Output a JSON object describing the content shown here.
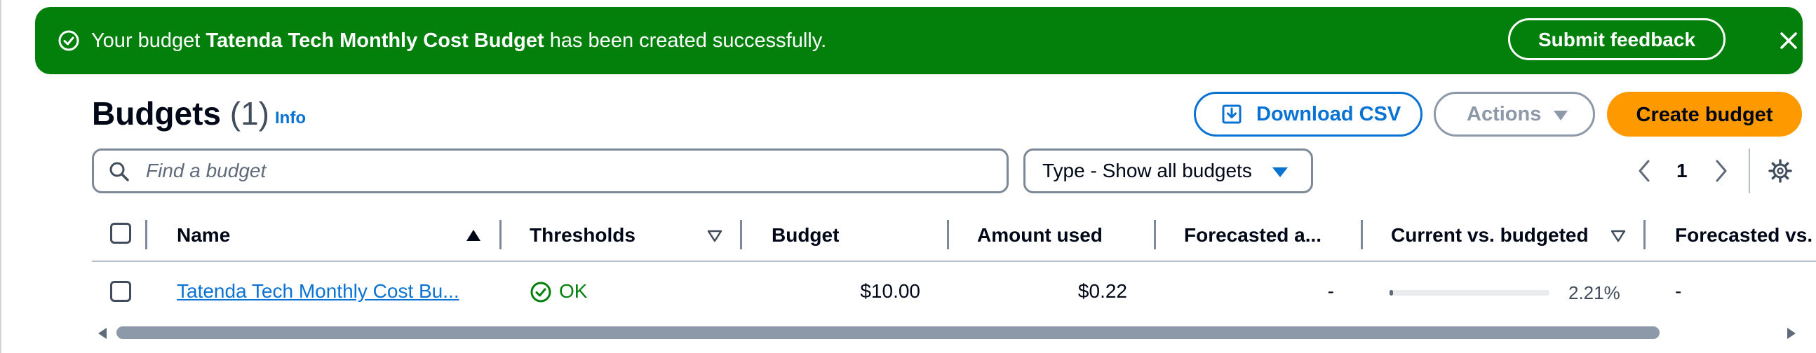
{
  "flash": {
    "message_prefix": "Your budget ",
    "budget_name": "Tatenda Tech Monthly Cost Budget",
    "message_suffix": " has been created successfully.",
    "feedback_label": "Submit feedback",
    "icons": {
      "status": "success-circle-check-icon",
      "close": "close-icon"
    },
    "color": "#037f0c"
  },
  "header": {
    "title": "Budgets",
    "count": "(1)",
    "info_label": "Info"
  },
  "toolbar": {
    "download_label": "Download CSV",
    "actions_label": "Actions",
    "create_label": "Create budget",
    "accent_color": "#0972d3",
    "primary_color": "#ff9900"
  },
  "search": {
    "placeholder": "Find a budget"
  },
  "filter": {
    "selected": "Type - Show all budgets"
  },
  "pagination": {
    "current_page": "1"
  },
  "table": {
    "columns": [
      "Name",
      "Thresholds",
      "Budget",
      "Amount used",
      "Forecasted a...",
      "Current vs. budgeted",
      "Forecasted vs."
    ],
    "sorted_column": "Name",
    "rows": [
      {
        "name": "Tatenda Tech Monthly Cost Bu...",
        "threshold_status": "OK",
        "budget": "$10.00",
        "amount_used": "$0.22",
        "forecasted_amount": "-",
        "current_vs_budgeted": "2.21%",
        "current_vs_budgeted_fraction": 0.0221,
        "forecasted_vs_budgeted": "-"
      }
    ]
  }
}
